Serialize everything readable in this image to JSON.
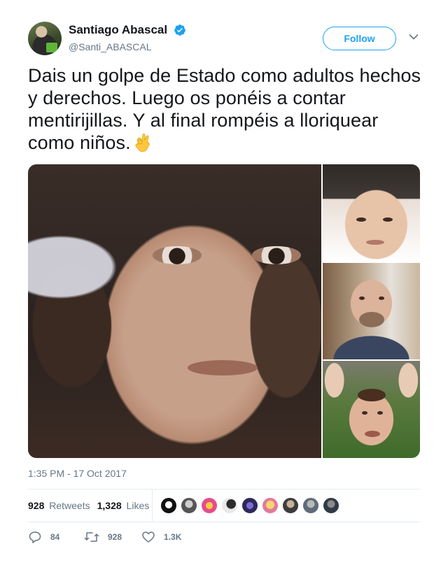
{
  "author": {
    "display_name": "Santiago Abascal",
    "handle": "@Santi_ABASCAL",
    "verified": true
  },
  "follow_button": {
    "label": "Follow"
  },
  "tweet": {
    "text": "Dais un golpe de Estado como adultos hechos y derechos. Luego os ponéis a contar mentirijillas. Y al final rompéis a lloriquear como niños.",
    "emoji": "ok-hand",
    "timestamp": "1:35 PM - 17 Oct 2017"
  },
  "stats": {
    "retweets_count": "928",
    "retweets_label": "Retweets",
    "likes_count": "1,328",
    "likes_label": "Likes"
  },
  "actions": {
    "replies": "84",
    "retweets": "928",
    "likes": "1.3K"
  },
  "colors": {
    "accent": "#1da1f2",
    "secondary_text": "#657786",
    "verified": "#1da1f2"
  },
  "liker_avatars": [
    "liker-1",
    "liker-2",
    "liker-3",
    "liker-4",
    "liker-5",
    "liker-6",
    "liker-7",
    "liker-8",
    "liker-9"
  ]
}
